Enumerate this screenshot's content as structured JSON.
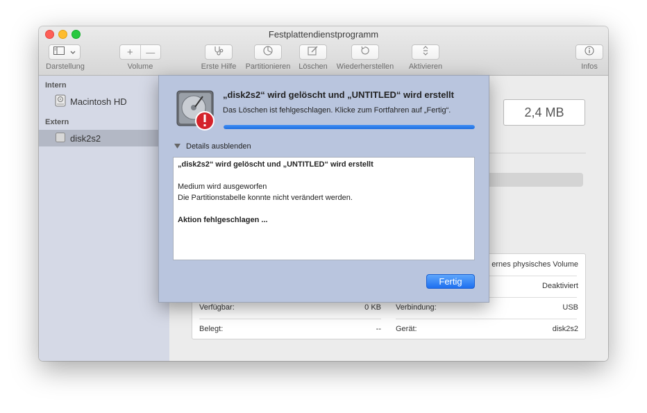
{
  "window": {
    "title": "Festplattendienstprogramm"
  },
  "toolbar": {
    "darstellung_label": "Darstellung",
    "volume_label": "Volume",
    "volume_add": "+",
    "volume_remove": "—",
    "erste_hilfe_label": "Erste Hilfe",
    "partitionieren_label": "Partitionieren",
    "loeschen_label": "Löschen",
    "wiederherstellen_label": "Wiederherstellen",
    "aktivieren_label": "Aktivieren",
    "infos_label": "Infos"
  },
  "sidebar": {
    "sections": [
      {
        "header": "Intern",
        "items": [
          {
            "label": "Macintosh HD",
            "icon": "internal-disk-icon"
          }
        ]
      },
      {
        "header": "Extern",
        "items": [
          {
            "label": "disk2s2",
            "icon": "external-disk-icon",
            "selected": true
          }
        ]
      }
    ]
  },
  "main": {
    "size": "2,4 MB",
    "info": {
      "row1_right_value": "ernes physisches Volume",
      "row2_right_value": "Deaktiviert",
      "verfuegbar_label": "Verfügbar:",
      "verfuegbar_value": "0 KB",
      "verbindung_label": "Verbindung:",
      "verbindung_value": "USB",
      "belegt_label": "Belegt:",
      "belegt_value": "--",
      "geraet_label": "Gerät:",
      "geraet_value": "disk2s2"
    }
  },
  "sheet": {
    "title": "„disk2s2“ wird gelöscht und „UNTITLED“ wird erstellt",
    "status": "Das Löschen ist fehlgeschlagen. Klicke zum Fortfahren auf „Fertig“.",
    "progress": 1.0,
    "details_toggle": "Details ausblenden",
    "details": {
      "line1": "„disk2s2“ wird gelöscht und „UNTITLED“ wird erstellt",
      "line2": "Medium wird ausgeworfen",
      "line3": "Die Partitionstabelle konnte nicht verändert werden.",
      "line4": "Aktion fehlgeschlagen ..."
    },
    "done_button": "Fertig"
  },
  "colors": {
    "accent": "#1f6fe0",
    "sheet_bg": "#b9c5de",
    "sidebar_bg": "#d5d9e6",
    "error_red": "#d4232b"
  }
}
